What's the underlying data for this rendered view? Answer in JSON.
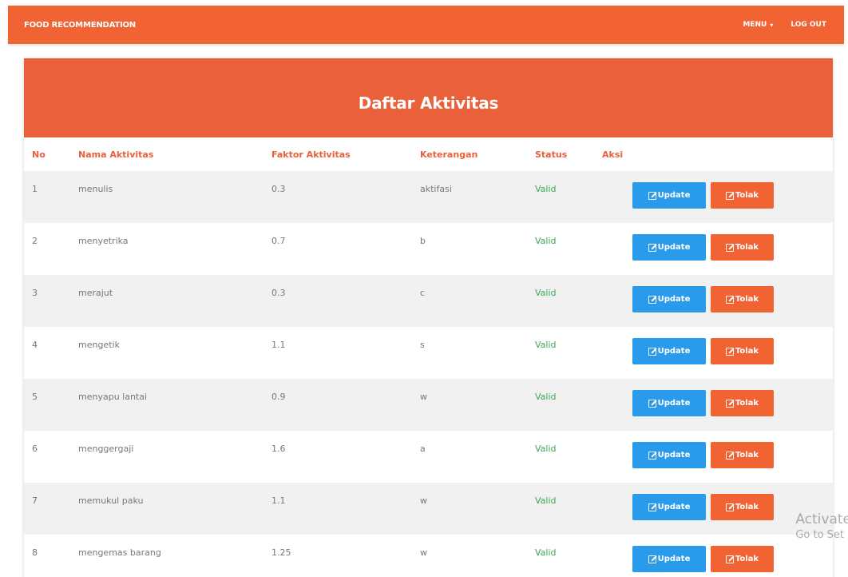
{
  "navbar": {
    "brand": "FOOD RECOMMENDATION",
    "menu_label": "MENU",
    "logout_label": "LOG OUT"
  },
  "card": {
    "title": "Daftar Aktivitas"
  },
  "table": {
    "headers": {
      "no": "No",
      "nama": "Nama Aktivitas",
      "faktor": "Faktor Aktivitas",
      "keterangan": "Keterangan",
      "status": "Status",
      "aksi": "Aksi"
    },
    "update_label": "Update",
    "tolak_label": "Tolak",
    "rows": [
      {
        "no": "1",
        "nama": "menulis",
        "faktor": "0.3",
        "keterangan": "aktifasi",
        "status": "Valid"
      },
      {
        "no": "2",
        "nama": "menyetrika",
        "faktor": "0.7",
        "keterangan": "b",
        "status": "Valid"
      },
      {
        "no": "3",
        "nama": "merajut",
        "faktor": "0.3",
        "keterangan": "c",
        "status": "Valid"
      },
      {
        "no": "4",
        "nama": "mengetik",
        "faktor": "1.1",
        "keterangan": "s",
        "status": "Valid"
      },
      {
        "no": "5",
        "nama": "menyapu lantai",
        "faktor": "0.9",
        "keterangan": "w",
        "status": "Valid"
      },
      {
        "no": "6",
        "nama": "menggergaji",
        "faktor": "1.6",
        "keterangan": "a",
        "status": "Valid"
      },
      {
        "no": "7",
        "nama": "memukul paku",
        "faktor": "1.1",
        "keterangan": "w",
        "status": "Valid"
      },
      {
        "no": "8",
        "nama": "mengemas barang",
        "faktor": "1.25",
        "keterangan": "w",
        "status": "Valid"
      }
    ]
  },
  "watermark": {
    "line1": "Activate",
    "line2": "Go to Set"
  },
  "colors": {
    "brand_orange": "#f26334",
    "update_blue": "#2a9bea",
    "valid_green": "#3aa856"
  }
}
